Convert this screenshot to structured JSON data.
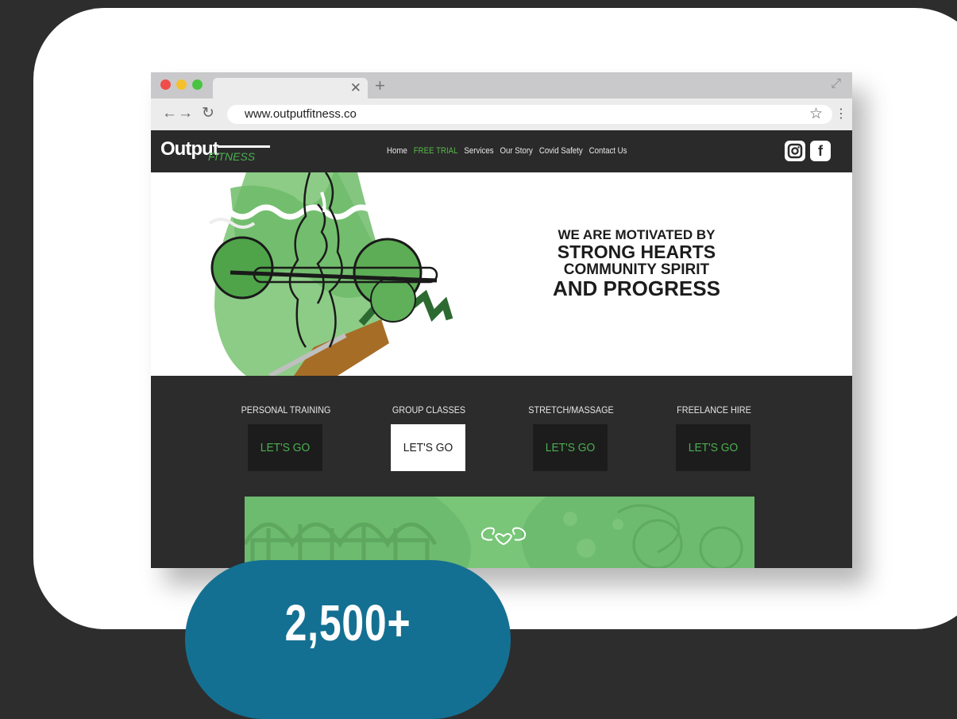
{
  "browser": {
    "url": "www.outputfitness.co"
  },
  "site": {
    "logo_main": "Output",
    "logo_sub": "FITNESS",
    "nav": [
      "Home",
      "FREE TRIAL",
      "Services",
      "Our Story",
      "Covid Safety",
      "Contact Us"
    ],
    "active_nav": "FREE TRIAL",
    "social_icons": [
      "instagram-icon",
      "facebook-icon"
    ]
  },
  "hero": {
    "line1": "WE ARE MOTIVATED BY",
    "line2": "STRONG HEARTS",
    "line3": "COMMUNITY SPIRIT",
    "line4": "AND PROGRESS"
  },
  "services": [
    {
      "label": "PERSONAL TRAINING",
      "button": "LET'S GO"
    },
    {
      "label": "GROUP CLASSES",
      "button": "LET'S GO"
    },
    {
      "label": "STRETCH/MASSAGE",
      "button": "LET'S GO"
    },
    {
      "label": "FREELANCE HIRE",
      "button": "LET'S GO"
    }
  ],
  "stat": {
    "value": "2,500+"
  },
  "colors": {
    "brand_green": "#4caf50",
    "dark": "#2c2c2c",
    "stat_blue": "#147092"
  }
}
